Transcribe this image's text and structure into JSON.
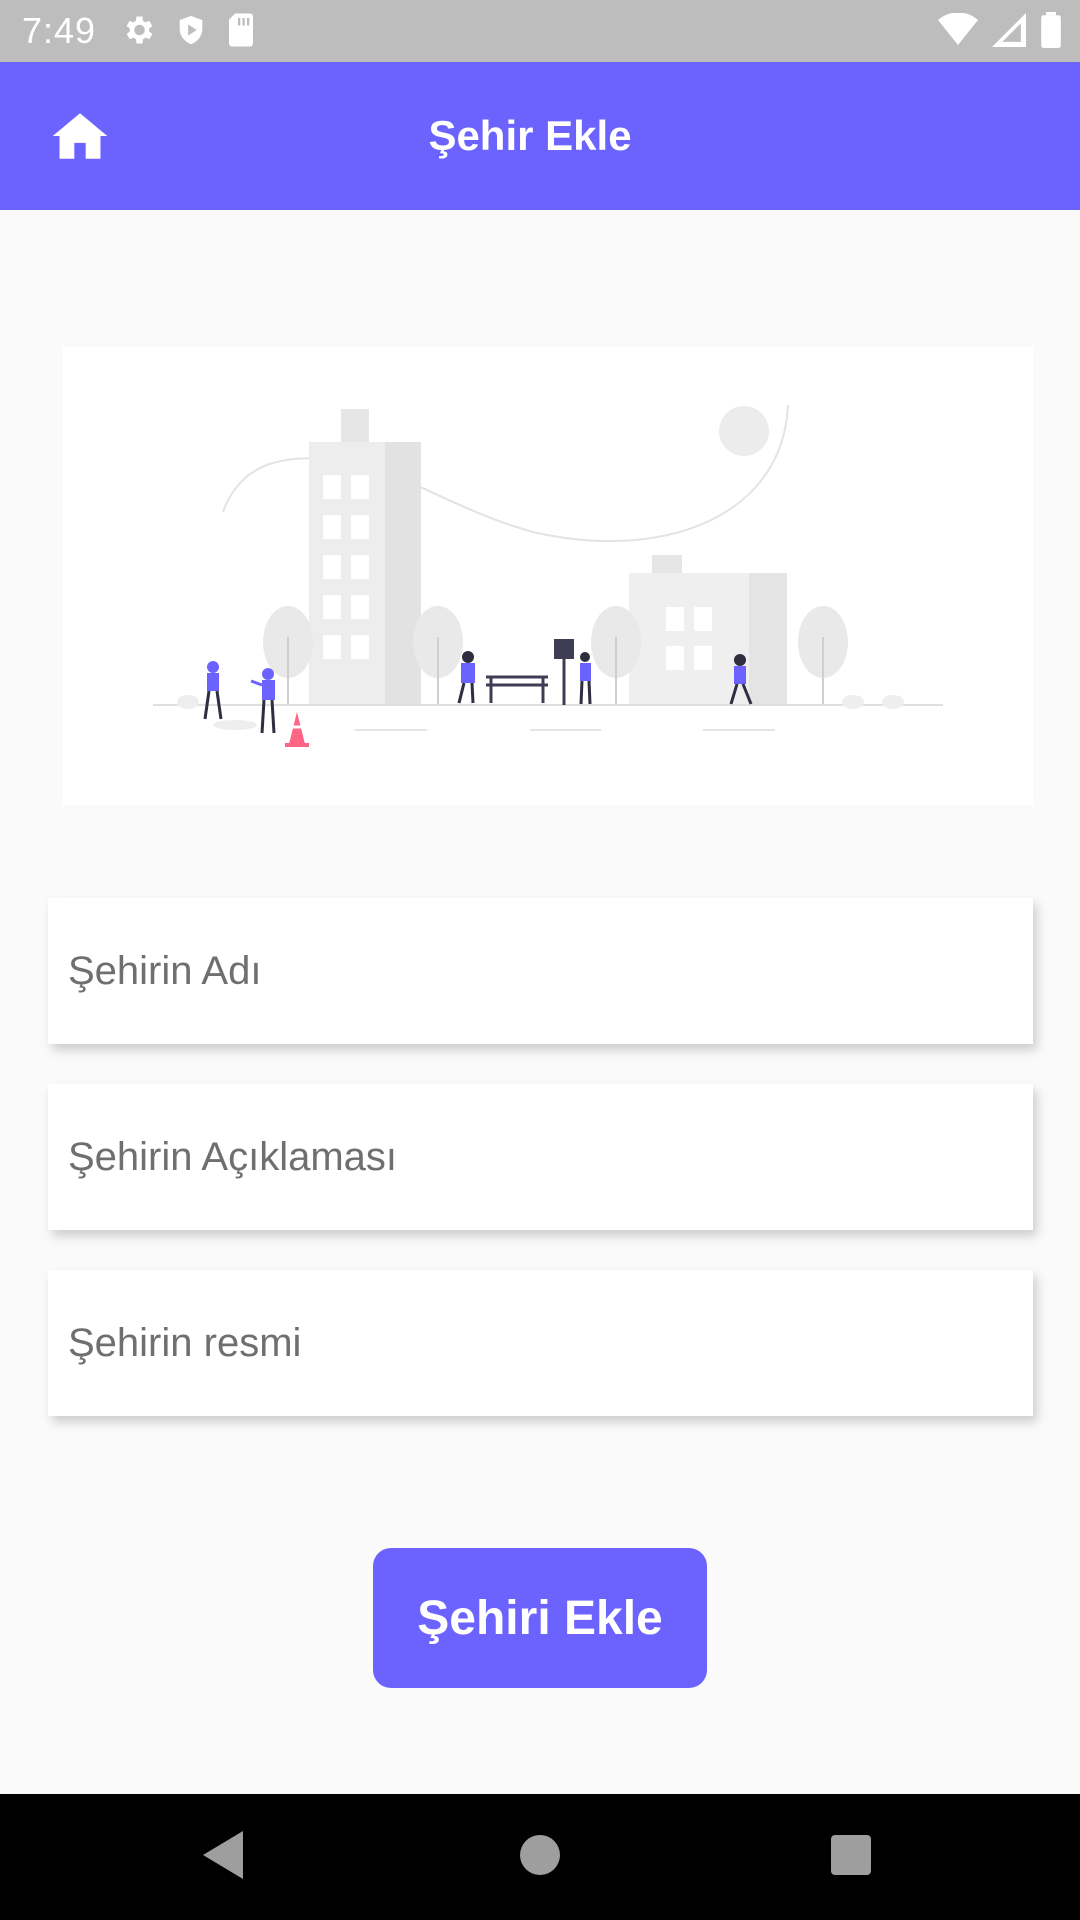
{
  "status_bar": {
    "time": "7:49",
    "left_icons": [
      "gear-icon",
      "shield-icon",
      "sd-card-icon"
    ],
    "right_icons": [
      "wifi-icon",
      "signal-icon",
      "battery-icon"
    ]
  },
  "app_bar": {
    "title": "Şehir Ekle",
    "home_icon": "home-icon",
    "color": "#6c63ff"
  },
  "form": {
    "name_placeholder": "Şehirin Adı",
    "name_value": "",
    "description_placeholder": "Şehirin Açıklaması",
    "description_value": "",
    "image_placeholder": "Şehirin resmi",
    "image_value": ""
  },
  "submit_label": "Şehiri Ekle",
  "nav_bar": {
    "icons": [
      "back-icon",
      "home-circle-icon",
      "recents-icon"
    ]
  }
}
